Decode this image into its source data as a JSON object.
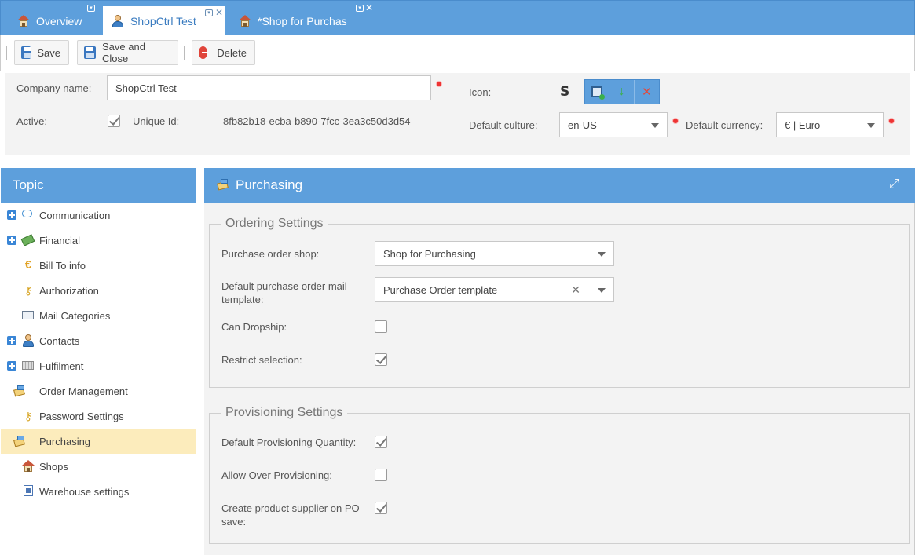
{
  "tabs": [
    {
      "label": "Overview"
    },
    {
      "label": "ShopCtrl Test"
    },
    {
      "label": "*Shop for Purchas"
    }
  ],
  "toolbar": {
    "save_label": "Save",
    "save_close_label": "Save and Close",
    "delete_label": "Delete"
  },
  "header": {
    "company_name_label": "Company name:",
    "company_name_value": "ShopCtrl Test",
    "active_label": "Active:",
    "active_checked": true,
    "unique_id_label": "Unique Id:",
    "unique_id_value": "8fb82b18-ecba-b890-7fcc-3ea3c50d3d54",
    "icon_label": "Icon:",
    "icon_glyph": "S",
    "default_culture_label": "Default culture:",
    "default_culture_value": "en-US",
    "default_currency_label": "Default currency:",
    "default_currency_value": "€ | Euro"
  },
  "topic": {
    "title": "Topic",
    "items": [
      {
        "label": "Communication",
        "icon": "speech-bubble-icon",
        "expandable": true
      },
      {
        "label": "Financial",
        "icon": "money-icon",
        "expandable": true
      },
      {
        "label": "Bill To info",
        "icon": "euro-icon",
        "expandable": false
      },
      {
        "label": "Authorization",
        "icon": "key-icon",
        "expandable": false
      },
      {
        "label": "Mail Categories",
        "icon": "mail-icon",
        "expandable": false
      },
      {
        "label": "Contacts",
        "icon": "person-icon",
        "expandable": true
      },
      {
        "label": "Fulfilment",
        "icon": "box-icon",
        "expandable": true
      },
      {
        "label": "Order Management",
        "icon": "order-icon",
        "expandable": false
      },
      {
        "label": "Password Settings",
        "icon": "key-icon",
        "expandable": false
      },
      {
        "label": "Purchasing",
        "icon": "purchasing-icon",
        "expandable": false,
        "selected": true
      },
      {
        "label": "Shops",
        "icon": "house-icon",
        "expandable": false
      },
      {
        "label": "Warehouse settings",
        "icon": "document-icon",
        "expandable": false
      }
    ]
  },
  "pane": {
    "title": "Purchasing",
    "ordering": {
      "legend": "Ordering Settings",
      "purchase_order_shop_label": "Purchase order shop:",
      "purchase_order_shop_value": "Shop for Purchasing",
      "mail_template_label": "Default purchase order mail template:",
      "mail_template_value": "Purchase Order template",
      "can_dropship_label": "Can Dropship:",
      "can_dropship_checked": false,
      "restrict_selection_label": "Restrict selection:",
      "restrict_selection_checked": true
    },
    "provisioning": {
      "legend": "Provisioning Settings",
      "default_qty_label": "Default Provisioning Quantity:",
      "default_qty_checked": true,
      "allow_over_label": "Allow Over Provisioning:",
      "allow_over_checked": false,
      "create_supplier_label": "Create product supplier on PO save:",
      "create_supplier_checked": true
    }
  },
  "colors": {
    "accent": "#5d9fdc",
    "selected_row": "#fcecbc",
    "required": "#e33333"
  }
}
